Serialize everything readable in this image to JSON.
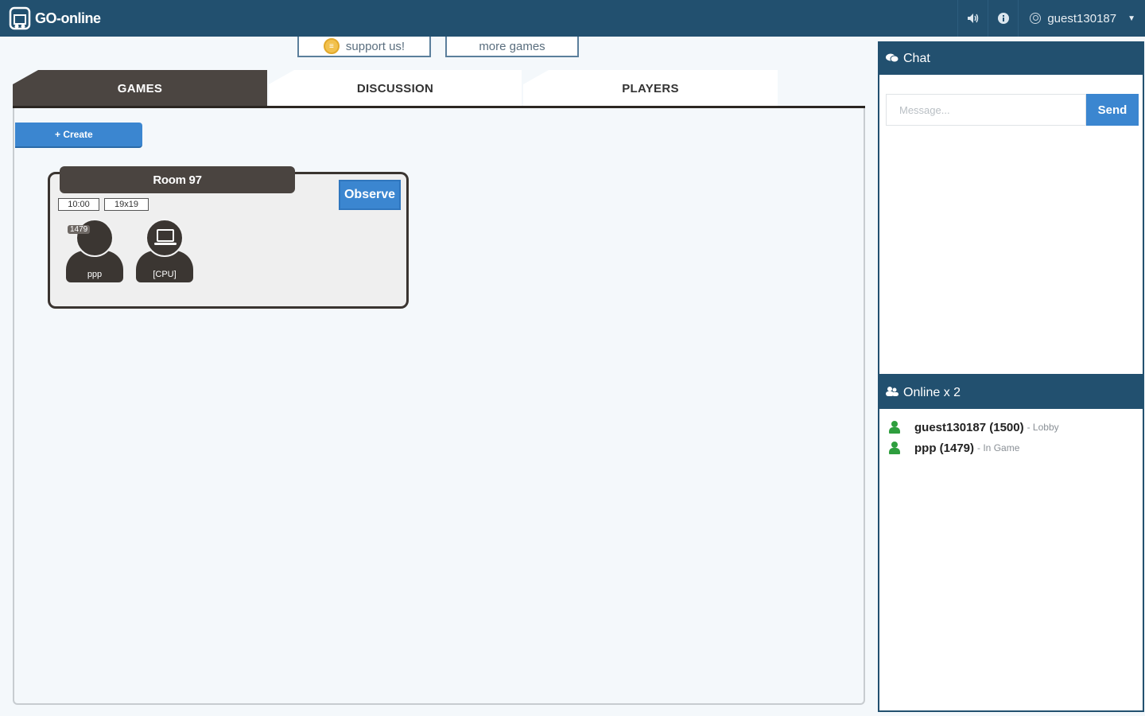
{
  "navbar": {
    "brand": "GO-online",
    "sound_icon": "speaker-icon",
    "info_icon": "info-icon",
    "username": "guest130187"
  },
  "top_links": {
    "support": "support us!",
    "more_games": "more games"
  },
  "tabs": [
    {
      "label": "GAMES",
      "active": true
    },
    {
      "label": "DISCUSSION",
      "active": false
    },
    {
      "label": "PLAYERS",
      "active": false
    }
  ],
  "main": {
    "create_label": "+ Create"
  },
  "rooms": [
    {
      "title": "Room 97",
      "observe_label": "Observe",
      "time": "10:00",
      "board": "19x19",
      "players": [
        {
          "name": "ppp",
          "rating": "1479"
        },
        {
          "name": "[CPU]"
        }
      ]
    }
  ],
  "chat": {
    "title": "Chat",
    "placeholder": "Message...",
    "send_label": "Send"
  },
  "online": {
    "title": "Online x 2",
    "users": [
      {
        "name": "guest130187 (1500)",
        "status": "- Lobby"
      },
      {
        "name": "ppp (1479)",
        "status": "- In Game"
      }
    ]
  },
  "colors": {
    "navbar": "#22506f",
    "accent": "#3b86d0",
    "dark_tab": "#4b4541",
    "online_icon": "#2e9e3e"
  }
}
